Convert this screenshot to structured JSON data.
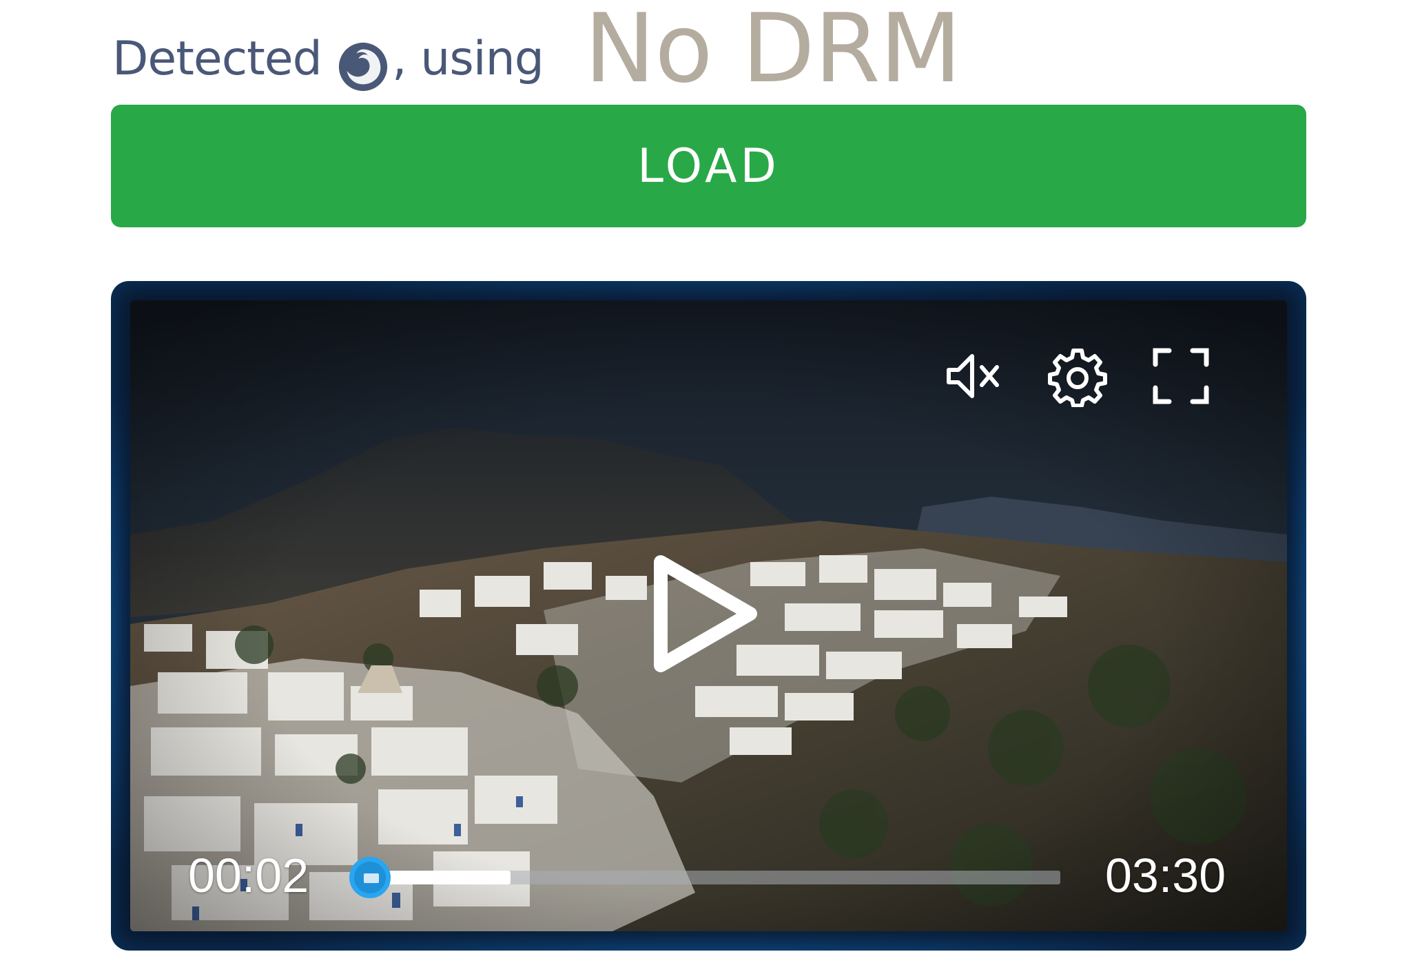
{
  "header": {
    "detected_label": "Detected",
    "browser_icon": "firefox-icon",
    "using_label": ", using",
    "drm_status": "No DRM"
  },
  "load_button": {
    "label": "LOAD"
  },
  "player": {
    "current_time": "00:02",
    "total_time": "03:30",
    "buffered_fraction": 0.19,
    "played_fraction": 0.01,
    "icons": {
      "mute": "mute-icon",
      "settings": "gear-icon",
      "fullscreen": "fullscreen-icon",
      "play": "play-icon"
    }
  },
  "colors": {
    "load_button": "#29a847",
    "header_text": "#4a5878",
    "drm_text": "#b5aca0",
    "player_glow": "#1a7fd0",
    "seek_handle": "#1e90d8"
  }
}
